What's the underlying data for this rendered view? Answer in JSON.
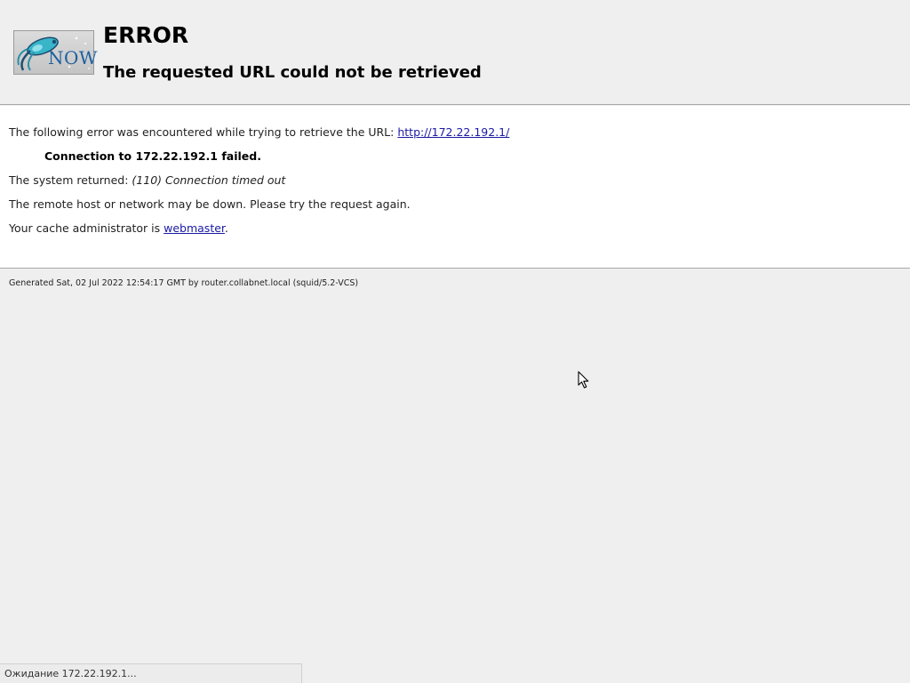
{
  "header": {
    "logo_text": "NOW",
    "error_title": "ERROR",
    "subtitle": "The requested URL could not be retrieved"
  },
  "content": {
    "line1_prefix": "The following error was encountered while trying to retrieve the URL: ",
    "url": "http://172.22.192.1/",
    "connection_failed": "Connection to 172.22.192.1 failed.",
    "system_returned_prefix": "The system returned: ",
    "system_error": "(110) Connection timed out",
    "remote_host_message": "The remote host or network may be down. Please try the request again.",
    "admin_prefix": "Your cache administrator is ",
    "admin_link": "webmaster",
    "admin_suffix": "."
  },
  "footer": {
    "generated": "Generated Sat, 02 Jul 2022 12:54:17 GMT by router.collabnet.local (squid/5.2-VCS)"
  },
  "statusbar": {
    "text": "Ожидание 172.22.192.1..."
  },
  "icons": {
    "logo": "squid-logo-icon",
    "cursor": "mouse-cursor-icon"
  },
  "colors": {
    "background": "#efefef",
    "content_background": "#ffffff",
    "link": "#1a1aa6",
    "logo_text": "#1e5fa0"
  }
}
